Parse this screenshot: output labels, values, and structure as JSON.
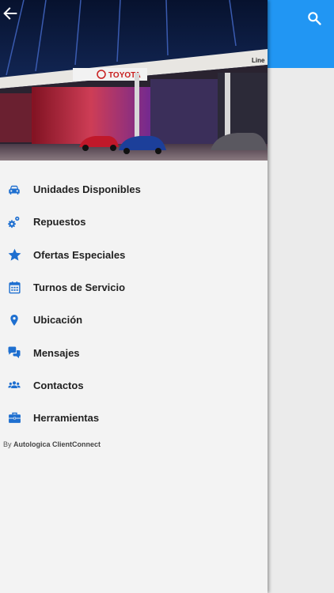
{
  "header": {
    "sign_brand": "TOYOTA",
    "sign_line": "Line"
  },
  "menu": {
    "items": [
      {
        "label": "Unidades Disponibles",
        "icon": "car-icon"
      },
      {
        "label": "Repuestos",
        "icon": "gears-icon"
      },
      {
        "label": "Ofertas Especiales",
        "icon": "star-icon"
      },
      {
        "label": "Turnos de Servicio",
        "icon": "calendar-icon"
      },
      {
        "label": "Ubicación",
        "icon": "location-pin-icon"
      },
      {
        "label": "Mensajes",
        "icon": "chat-bubbles-icon"
      },
      {
        "label": "Contactos",
        "icon": "people-icon"
      },
      {
        "label": "Herramientas",
        "icon": "toolbox-icon"
      }
    ]
  },
  "footer": {
    "prefix": "By",
    "brand": "Autologica ClientConnect"
  },
  "colors": {
    "accent": "#2196f3",
    "icon": "#1e6fd0",
    "drawer_bg": "#f3f3f3",
    "page_bg": "#ebebeb"
  }
}
